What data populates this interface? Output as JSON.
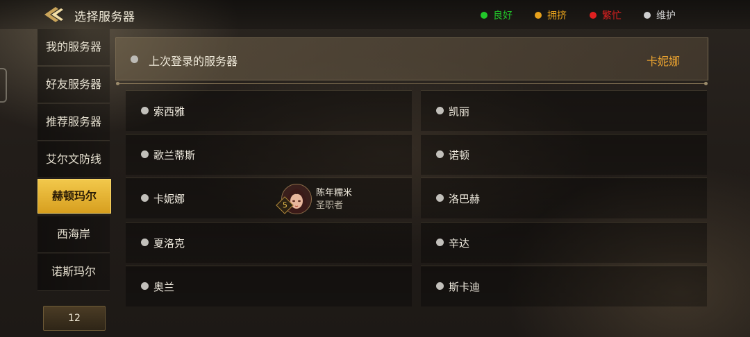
{
  "header": {
    "title": "选择服务器",
    "legend": [
      {
        "label": "良好",
        "color": "#22c72a"
      },
      {
        "label": "拥挤",
        "color": "#e7a11c"
      },
      {
        "label": "繁忙",
        "color": "#e02020"
      },
      {
        "label": "维护",
        "color": "#cfcfcf"
      }
    ]
  },
  "sidebar": {
    "items": [
      {
        "label": "我的服务器"
      },
      {
        "label": "好友服务器"
      },
      {
        "label": "推荐服务器"
      },
      {
        "label": "艾尔文防线"
      },
      {
        "label": "赫顿玛尔",
        "active": true
      },
      {
        "label": "西海岸"
      },
      {
        "label": "诺斯玛尔"
      }
    ],
    "page_label": "12"
  },
  "last_login": {
    "label": "上次登录的服务器",
    "server": "卡妮娜"
  },
  "servers": [
    {
      "name": "索西雅"
    },
    {
      "name": "凯丽"
    },
    {
      "name": "歌兰蒂斯"
    },
    {
      "name": "诺顿"
    },
    {
      "name": "卡妮娜",
      "character": {
        "name": "陈年糯米",
        "class": "圣职者",
        "level": "5"
      }
    },
    {
      "name": "洛巴赫"
    },
    {
      "name": "夏洛克"
    },
    {
      "name": "辛达"
    },
    {
      "name": "奥兰"
    },
    {
      "name": "斯卡迪"
    }
  ],
  "colors": {
    "accent": "#e7a130",
    "active_tab": "#e8b636",
    "status_maintenance": "#c2c0bb"
  }
}
